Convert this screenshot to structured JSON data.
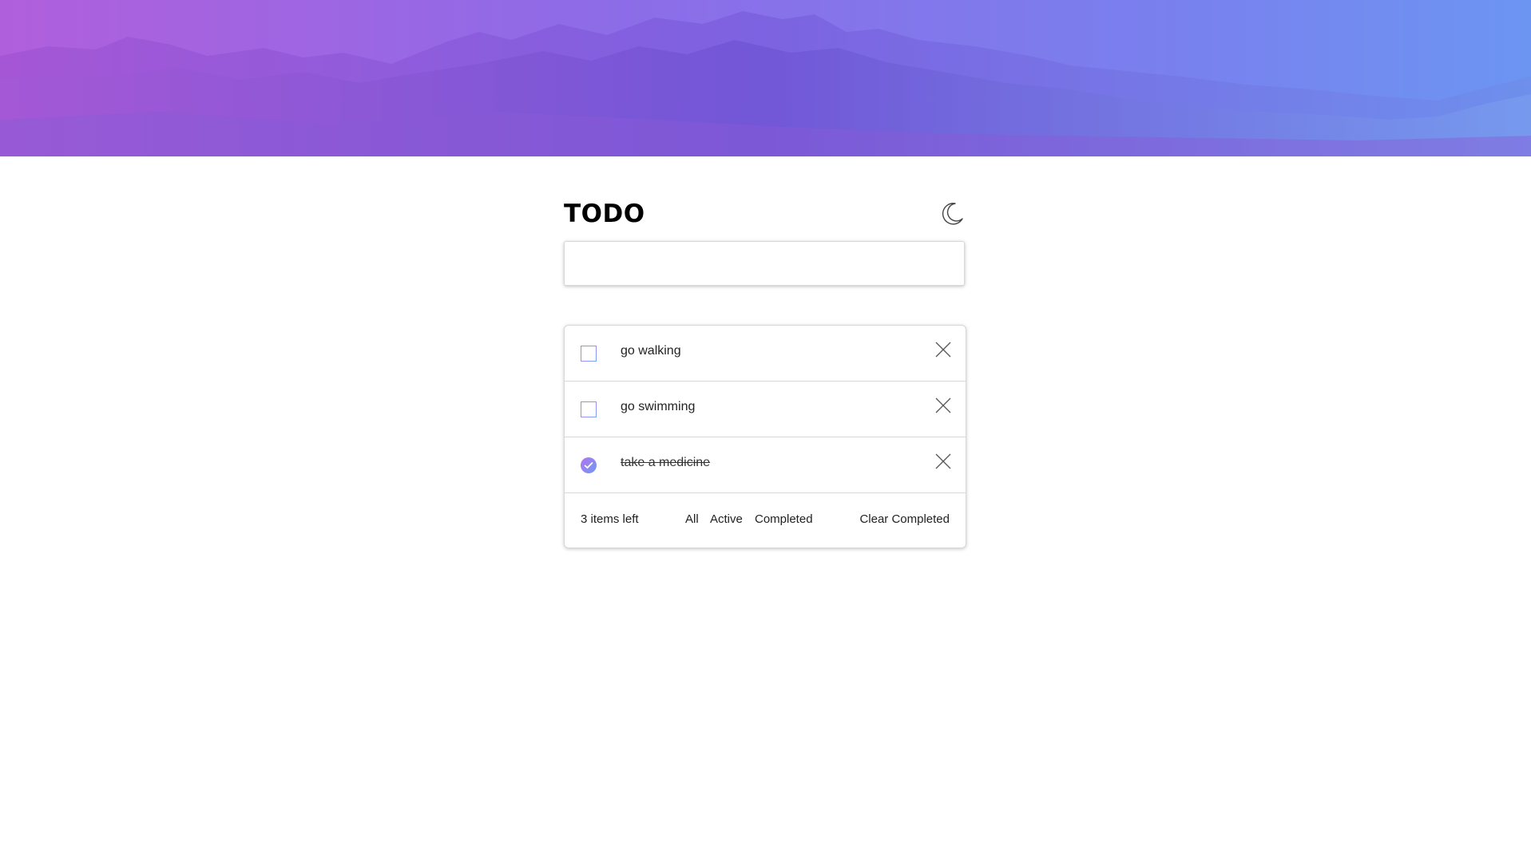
{
  "app": {
    "title": "TODO",
    "theme_toggle_icon": "moon-icon"
  },
  "new_todo": {
    "value": "",
    "placeholder": ""
  },
  "todos": [
    {
      "text": "go walking",
      "completed": false
    },
    {
      "text": "go swimming",
      "completed": false
    },
    {
      "text": "take a medicine",
      "completed": true
    }
  ],
  "footer": {
    "items_left": "3 items left",
    "filters": [
      "All",
      "Active",
      "Completed"
    ],
    "clear_label": "Clear Completed"
  },
  "colors": {
    "gradient_start": "#d46bf3",
    "gradient_end": "#6ea6f6",
    "hero_left": "#b05fdc",
    "hero_right": "#6c95f2"
  }
}
